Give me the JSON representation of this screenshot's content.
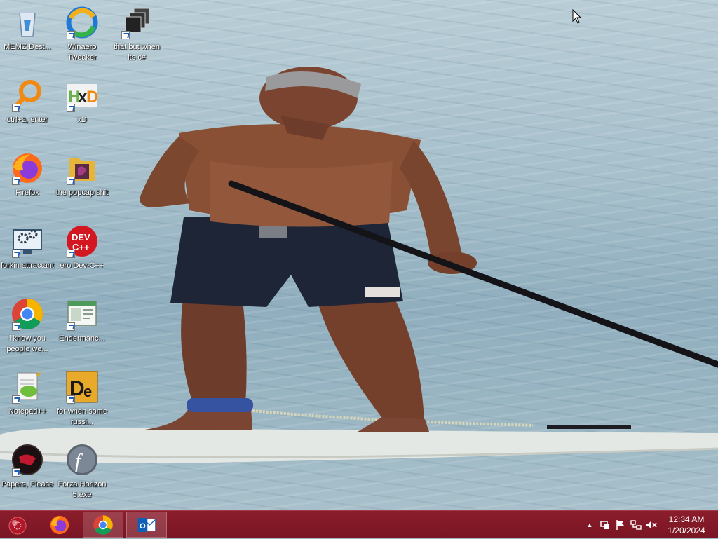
{
  "desktop": {
    "icons": [
      {
        "label": "MEMZ-Dest...",
        "icon": "recycle-bin-icon"
      },
      {
        "label": "Winaero Tweaker",
        "icon": "winaero-tweaker-icon"
      },
      {
        "label": "that but when its c#",
        "icon": "stacked-windows-icon"
      },
      {
        "label": "ctrl+a, enter",
        "icon": "magnifier-icon"
      },
      {
        "label": "xD",
        "icon": "hxd-icon"
      },
      {
        "label": "Firefox",
        "icon": "firefox-icon"
      },
      {
        "label": "the popcap shit",
        "icon": "folder-icon"
      },
      {
        "label": "forkin attractant",
        "icon": "settings-monitor-icon"
      },
      {
        "label": "ero Dev-C++",
        "icon": "devcpp-icon"
      },
      {
        "label": "i know you people we...",
        "icon": "chrome-icon"
      },
      {
        "label": "Endermanc...",
        "icon": "window-app-icon"
      },
      {
        "label": "Notepad++",
        "icon": "notepadpp-icon"
      },
      {
        "label": "for when some russi...",
        "icon": "die-icon"
      },
      {
        "label": "Papers, Please",
        "icon": "papers-please-icon"
      },
      {
        "label": "Forza Horizon 5.exe",
        "icon": "flash-icon"
      }
    ]
  },
  "taskbar": {
    "start_icon": "start-orb-icon",
    "apps": [
      {
        "name": "firefox",
        "icon": "firefox-icon",
        "active": false
      },
      {
        "name": "chrome",
        "icon": "chrome-icon",
        "active": true
      },
      {
        "name": "outlook",
        "icon": "outlook-icon",
        "active": true
      }
    ],
    "tray": {
      "show_hidden": "▲",
      "icons": [
        "network-adapter-icon",
        "action-center-flag-icon",
        "network-icon",
        "volume-muted-icon"
      ]
    },
    "clock": {
      "time": "12:34 AM",
      "date": "1/20/2024"
    }
  },
  "colors": {
    "taskbar": "#7a1523",
    "water": "#9fb9c6"
  }
}
